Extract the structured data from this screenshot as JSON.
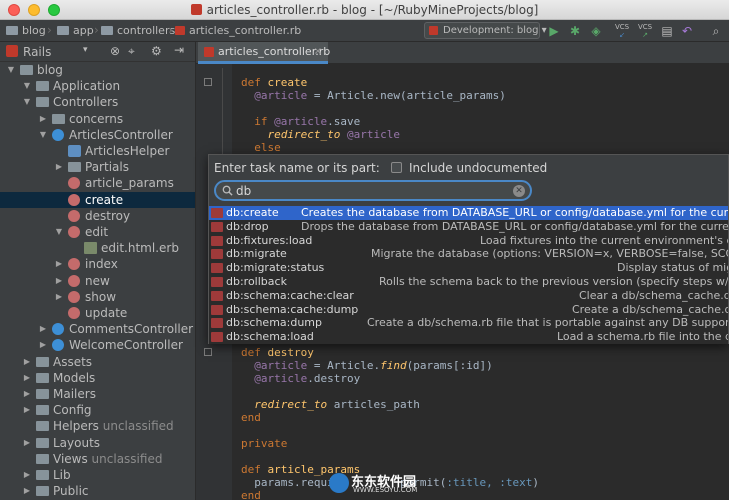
{
  "window": {
    "title": "articles_controller.rb - blog - [~/RubyMineProjects/blog]"
  },
  "breadcrumbs": [
    "blog",
    "app",
    "controllers",
    "articles_controller.rb"
  ],
  "toolbar": {
    "run_config": "Development: blog",
    "vcs1": "VCS",
    "vcs2": "VCS"
  },
  "sidebar": {
    "header": "Rails",
    "tree": [
      {
        "label": "blog",
        "kind": "folder"
      },
      {
        "label": "Application",
        "kind": "folder"
      },
      {
        "label": "Controllers",
        "kind": "folder"
      },
      {
        "label": "concerns",
        "kind": "folder"
      },
      {
        "label": "ArticlesController",
        "kind": "class"
      },
      {
        "label": "ArticlesHelper",
        "kind": "helper"
      },
      {
        "label": "Partials",
        "kind": "folder"
      },
      {
        "label": "article_params",
        "kind": "method"
      },
      {
        "label": "create",
        "kind": "method",
        "selected": true
      },
      {
        "label": "destroy",
        "kind": "method"
      },
      {
        "label": "edit",
        "kind": "method"
      },
      {
        "label": "edit.html.erb",
        "kind": "erb"
      },
      {
        "label": "index",
        "kind": "method"
      },
      {
        "label": "new",
        "kind": "method"
      },
      {
        "label": "show",
        "kind": "method"
      },
      {
        "label": "update",
        "kind": "method"
      },
      {
        "label": "CommentsController",
        "kind": "class"
      },
      {
        "label": "WelcomeController",
        "kind": "class"
      },
      {
        "label": "Assets",
        "kind": "folder"
      },
      {
        "label": "Models",
        "kind": "folder"
      },
      {
        "label": "Mailers",
        "kind": "folder"
      },
      {
        "label": "Config",
        "kind": "folder"
      },
      {
        "label": "Helpers",
        "kind": "folder",
        "suffix": "unclassified"
      },
      {
        "label": "Layouts",
        "kind": "folder"
      },
      {
        "label": "Views",
        "kind": "folder",
        "suffix": "unclassified"
      },
      {
        "label": "Lib",
        "kind": "folder"
      },
      {
        "label": "Public",
        "kind": "folder"
      }
    ]
  },
  "editor": {
    "tab": "articles_controller.rb",
    "code_top": {
      "l1_kw": "def",
      "l1_name": "create",
      "l2_ivar": "@article",
      "l2_rest": " = ",
      "l2_const": "Article",
      "l2_call": ".new(article_params)",
      "l3_kw": "if",
      "l3_ivar": "@article",
      "l3_call": ".save",
      "l4_mth": "redirect_to",
      "l4_ivar": "@article",
      "l5_kw": "else"
    },
    "code_bottom": {
      "l1_kw": "def",
      "l1_name": "destroy",
      "l2_ivar": "@article",
      "l2_rest": " = ",
      "l2_const": "Article",
      "l2_find": "find",
      "l2_args": "(params[:id])",
      "l3_ivar": "@article",
      "l3_call": ".destroy",
      "l4_mth": "redirect_to",
      "l4_arg": " articles_path",
      "l5_kw": "end",
      "l6_kw": "private",
      "l7_kw": "def",
      "l7_name": "article_params",
      "l8_a": "params.requi",
      "l8_b": "permit(",
      "l8_sym": ":title, :text",
      "l8_c": ")",
      "l9_kw": "end"
    }
  },
  "popup": {
    "title": "Enter task name or its part:",
    "include_label": "Include undocumented",
    "search_value": "db",
    "tasks": [
      {
        "name": "db:create",
        "desc": "Creates the database from DATABASE_URL or config/database.yml for the current RAILS_ENV",
        "selected": true
      },
      {
        "name": "db:drop",
        "desc": "Drops the database from DATABASE_URL or config/database.yml for the current RAILS_ENV"
      },
      {
        "name": "db:fixtures:load",
        "desc": "Load fixtures into the current environment's database"
      },
      {
        "name": "db:migrate",
        "desc": "Migrate the database (options: VERSION=x, VERBOSE=false, SCOPE=blog)"
      },
      {
        "name": "db:migrate:status",
        "desc": "Display status of migrations"
      },
      {
        "name": "db:rollback",
        "desc": "Rolls the schema back to the previous version (specify steps w/ STEP=n)"
      },
      {
        "name": "db:schema:cache:clear",
        "desc": "Clear a db/schema_cache.dump file"
      },
      {
        "name": "db:schema:cache:dump",
        "desc": "Create a db/schema_cache.dump file"
      },
      {
        "name": "db:schema:dump",
        "desc": "Create a db/schema.rb file that is portable against any DB supported by AR"
      },
      {
        "name": "db:schema:load",
        "desc": "Load a schema.rb file into the database"
      }
    ]
  },
  "watermark": {
    "text": "东东软件园",
    "url": "WWW.ESOYU.COM"
  }
}
